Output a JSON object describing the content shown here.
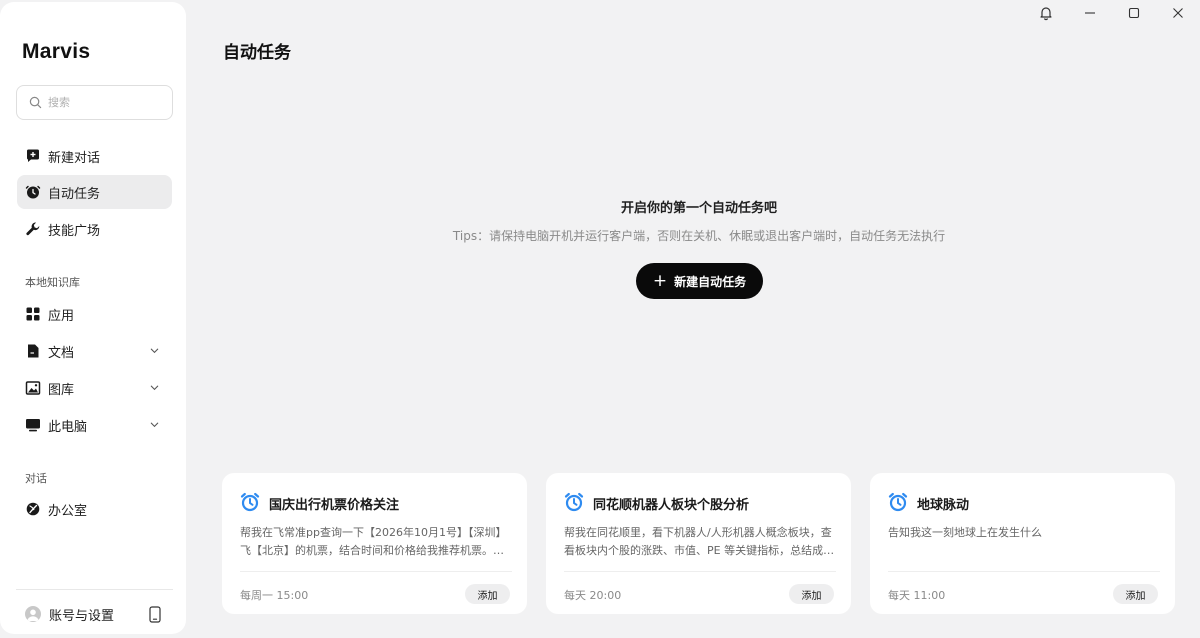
{
  "app": {
    "name": "Marvis"
  },
  "search": {
    "placeholder": "搜索"
  },
  "nav": {
    "new_chat": "新建对话",
    "auto_tasks": "自动任务",
    "skills": "技能广场"
  },
  "knowledge": {
    "section_label": "本地知识库",
    "apps": "应用",
    "documents": "文档",
    "gallery": "图库",
    "this_pc": "此电脑"
  },
  "dialog": {
    "section_label": "对话",
    "office": "办公室"
  },
  "account": {
    "label": "账号与设置"
  },
  "main": {
    "title": "自动任务",
    "empty_title": "开启你的第一个自动任务吧",
    "tips": "Tips：请保持电脑开机并运行客户端，否则在关机、休眠或退出客户端时，自动任务无法执行",
    "new_task_label": "新建自动任务"
  },
  "templates": [
    {
      "title": "国庆出行机票价格关注",
      "description": "帮我在飞常准pp查询一下【2026年10月1号】【深圳】飞【北京】的机票，结合时间和价格给我推荐机票。如果有合适的机票，提醒我。",
      "schedule": "每周一 15:00",
      "add_label": "添加"
    },
    {
      "title": "同花顺机器人板块个股分析",
      "description": "帮我在同花顺里，看下机器人/人形机器人概念板块，查看板块内个股的涨跌、市值、PE 等关键指标，总结成一份简报。",
      "schedule": "每天 20:00",
      "add_label": "添加"
    },
    {
      "title": "地球脉动",
      "description": "告知我这一刻地球上在发生什么",
      "schedule": "每天 11:00",
      "add_label": "添加"
    }
  ],
  "colors": {
    "accent": "#0a0a0a",
    "alarm_icon": "#2f8bf0",
    "background": "#f2f2f3"
  },
  "icons": {
    "new_chat": "chat-plus-icon",
    "auto_tasks": "clock-icon",
    "skills": "wrench-icon",
    "apps": "grid-icon",
    "documents": "document-icon",
    "gallery": "image-icon",
    "this_pc": "monitor-icon",
    "office": "office-icon",
    "card": "alarm-clock-icon"
  }
}
